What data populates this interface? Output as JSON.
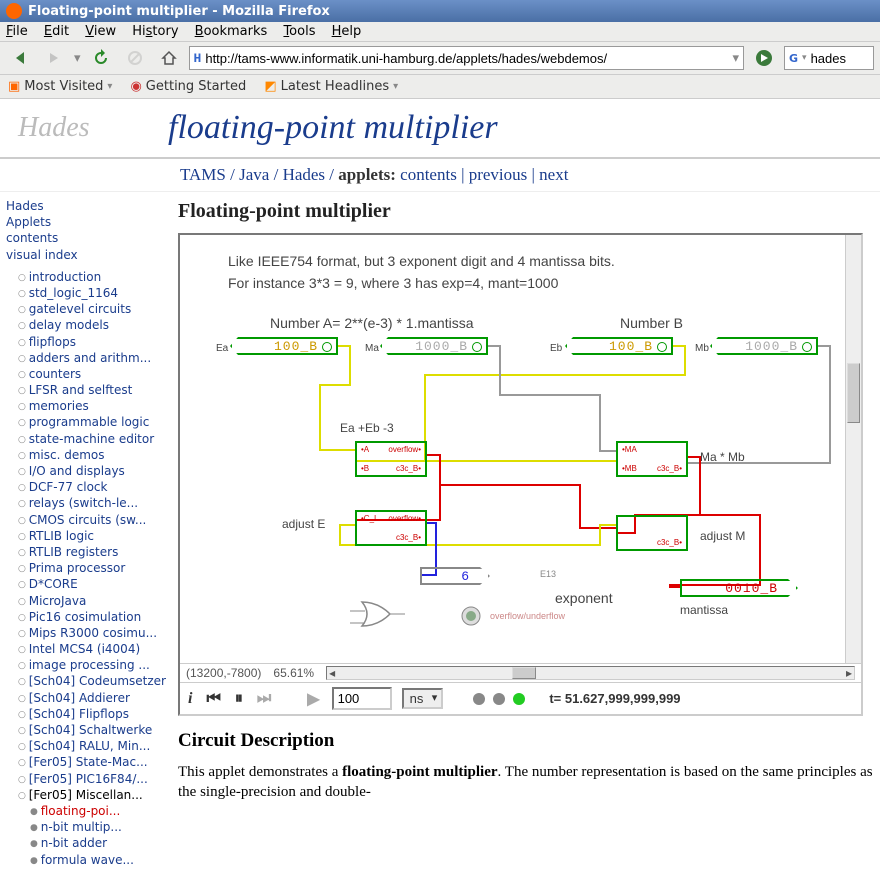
{
  "window": {
    "title": "Floating-point multiplier - Mozilla Firefox"
  },
  "menus": {
    "file": "File",
    "edit": "Edit",
    "view": "View",
    "history": "History",
    "bookmarks": "Bookmarks",
    "tools": "Tools",
    "help": "Help"
  },
  "url": "http://tams-www.informatik.uni-hamburg.de/applets/hades/webdemos/",
  "search_value": "hades",
  "bookmarks": {
    "most": "Most Visited",
    "getting": "Getting Started",
    "latest": "Latest Headlines"
  },
  "logo": "Hades",
  "title": "floating-point multiplier",
  "breadcrumb": {
    "tams": "TAMS",
    "java": "Java",
    "hades": "Hades",
    "applets": "applets:",
    "contents": "contents",
    "previous": "previous",
    "next": "next"
  },
  "sidebar": {
    "top": [
      "Hades",
      "Applets",
      "contents",
      "visual index"
    ],
    "items": [
      "introduction",
      "std_logic_1164",
      "gatelevel circuits",
      "delay models",
      "flipflops",
      "adders and arithm...",
      "counters",
      "LFSR and selftest",
      "memories",
      "programmable logic",
      "state-machine editor",
      "misc. demos",
      "I/O and displays",
      "DCF-77 clock",
      "relays (switch-le...",
      "CMOS circuits (sw...",
      "RTLIB logic",
      "RTLIB registers",
      "Prima processor",
      "D*CORE",
      "MicroJava",
      "Pic16 cosimulation",
      "Mips R3000 cosimu...",
      "Intel MCS4 (i4004)",
      "image processing ...",
      "[Sch04] Codeumsetzer",
      "[Sch04] Addierer",
      "[Sch04] Flipflops",
      "[Sch04] Schaltwerke",
      "[Sch04] RALU, Min...",
      "[Fer05] State-Mac...",
      "[Fer05] PIC16F84/...",
      "[Fer05] Miscellan..."
    ],
    "sub": [
      "floating-poi...",
      "n-bit multip...",
      "n-bit adder",
      "formula wave..."
    ]
  },
  "content": {
    "h2": "Floating-point multiplier",
    "canvas": {
      "line1": "Like IEEE754 format, but 3 exponent digit and 4 mantissa bits.",
      "line2": "For instance 3*3 = 9, where 3 has exp=4, mant=1000",
      "numA": "Number A= 2**(e-3) * 1.mantissa",
      "numB": "Number B",
      "Ea": "Ea",
      "Ma": "Ma",
      "Eb": "Eb",
      "Mb": "Mb",
      "reg_ea": "100_B",
      "reg_ma": "1000_B",
      "reg_eb": "100_B",
      "reg_mb": "1000_B",
      "lbl_add": "Ea +Eb -3",
      "lbl_mul": "Ma * Mb",
      "lbl_adjE": "adjust E",
      "lbl_adjM": "adjust M",
      "lbl_exp": "exponent",
      "lbl_mant": "mantissa",
      "out_exp": "6",
      "out_mant": "0010_B",
      "overflow": "overflow/underflow",
      "E13": "E13"
    },
    "status": {
      "coords": "(13200,-7800)",
      "zoom": "65.61%"
    },
    "controls": {
      "info": "i",
      "rw": "⏮",
      "pause": "⏸",
      "ff": "⏭",
      "play": "▶",
      "time_val": "100",
      "time_unit": "ns",
      "time_display": "t= 51.627,999,999,999"
    },
    "desc_h": "Circuit Description",
    "desc_p1a": "This applet demonstrates a ",
    "desc_p1b": "floating-point multiplier",
    "desc_p1c": ". The number representation is based on the same principles as the single-precision and double-"
  }
}
